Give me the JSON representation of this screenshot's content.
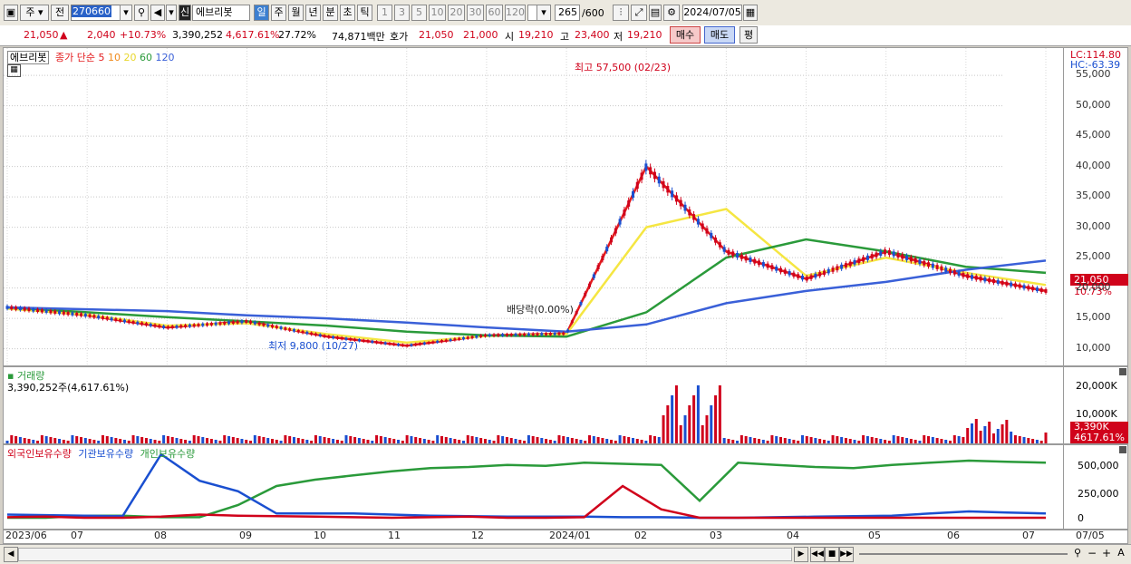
{
  "toolbar": {
    "tab_stock": "주",
    "tab_prev": "전",
    "code": "270660",
    "name": "에브리봇",
    "shin": "신",
    "periods": [
      "일",
      "주",
      "월",
      "년",
      "분",
      "초",
      "틱"
    ],
    "intervals": [
      "1",
      "3",
      "5",
      "10",
      "20",
      "30",
      "60",
      "120"
    ],
    "count": "265",
    "total": "/600",
    "date": "2024/07/05"
  },
  "quote": {
    "price": "21,050",
    "change": "2,040",
    "change_pct": "+10.73%",
    "volume": "3,390,252",
    "volume_pct": "4,617.61%",
    "turnover": "27.72%",
    "amount": "74,871백만",
    "bid_label": "호가",
    "bid": "21,050",
    "ask": "21,000",
    "open_label": "시",
    "open": "19,210",
    "high_label": "고",
    "high": "23,400",
    "low_label": "저",
    "low": "19,210",
    "buy_btn": "매수",
    "sell_btn": "매도",
    "eval_btn": "평"
  },
  "price_panel": {
    "legend_name": "에브리봇",
    "legend_ma": "종가 단순 5",
    "ma10": "10",
    "ma20": "20",
    "ma60": "60",
    "ma120": "120",
    "lc": "LC:114.80",
    "hc": "HC:-63.39",
    "high_note": "최고 57,500 (02/23)",
    "low_note": "최저 9,800 (10/27)",
    "div_note": "배당락(0.00%)",
    "cur_price_tag": "21,050",
    "cur_pct_tag": "10.73%",
    "y_ticks": [
      "55,000",
      "50,000",
      "45,000",
      "40,000",
      "35,000",
      "30,000",
      "25,000",
      "20,000",
      "15,000",
      "10,000"
    ]
  },
  "volume_panel": {
    "title": "거래량",
    "value": "3,390,252주(4,617.61%)",
    "y_ticks": [
      "20,000K",
      "10,000K"
    ],
    "cur_tag": "3,390K",
    "cur_pct": "4617.61%"
  },
  "holdings_panel": {
    "foreign": "외국인보유수량",
    "inst": "기관보유수량",
    "retail": "개인보유수량",
    "y_ticks": [
      "500,000",
      "250,000",
      "0"
    ]
  },
  "x_labels": [
    "2023/06",
    "07",
    "08",
    "09",
    "10",
    "11",
    "12",
    "2024/01",
    "02",
    "03",
    "04",
    "05",
    "06",
    "07",
    "07/05"
  ],
  "colors": {
    "up": "#d0021b",
    "down": "#1a4fd0",
    "ma5": "#e31a1c",
    "ma10": "#f08a1c",
    "ma20": "#f5e642",
    "ma60": "#2a9a3a",
    "ma120": "#3a60d8"
  },
  "chart_data": {
    "type": "line",
    "x": [
      "2023/06",
      "07",
      "08",
      "09",
      "10",
      "11",
      "12",
      "2024/01",
      "02",
      "03",
      "04",
      "05",
      "06",
      "07"
    ],
    "series": [
      {
        "name": "종가 단순 5",
        "values": [
          16800,
          15500,
          13500,
          14500,
          12000,
          10500,
          12200,
          12500,
          40000,
          26000,
          21500,
          26000,
          22000,
          19500
        ]
      },
      {
        "name": "20",
        "values": [
          16600,
          15600,
          13800,
          14200,
          12400,
          11000,
          12100,
          12400,
          30000,
          33000,
          22000,
          25000,
          22500,
          20500
        ]
      },
      {
        "name": "60",
        "values": [
          16800,
          16000,
          15200,
          14500,
          13800,
          12800,
          12200,
          12000,
          16000,
          25000,
          28000,
          26000,
          23500,
          22500
        ]
      },
      {
        "name": "120",
        "values": [
          16800,
          16500,
          16200,
          15500,
          15000,
          14300,
          13500,
          12800,
          14000,
          17500,
          19500,
          21000,
          23000,
          24500
        ]
      }
    ],
    "ylim": [
      8000,
      58000
    ]
  }
}
